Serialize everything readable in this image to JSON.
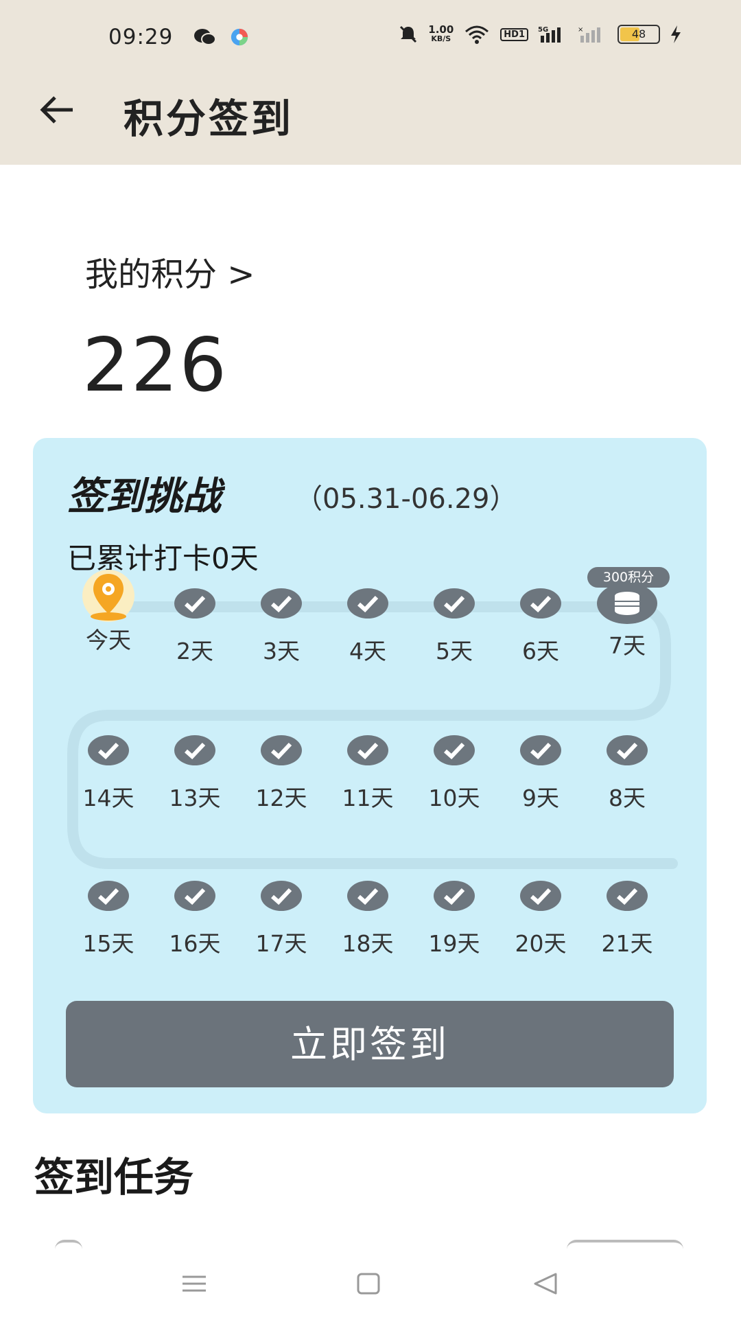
{
  "status_bar": {
    "time": "09:29",
    "speed_top": "1.00",
    "speed_bottom": "KB/S",
    "hd_badge": "HD1",
    "network": "5G",
    "battery": "48",
    "icons": [
      "wechat-icon",
      "app-icon",
      "mute-icon",
      "wifi-icon",
      "signal-icon",
      "charging-icon"
    ]
  },
  "header": {
    "back": "back-arrow-icon",
    "title": "积分签到"
  },
  "points": {
    "label": "我的积分 >",
    "value": "226"
  },
  "challenge": {
    "title": "签到挑战",
    "date_range": "（05.31-06.29）",
    "summary": "已累计打卡0天",
    "reward_tag": "300积分",
    "days_row1": [
      "今天",
      "2天",
      "3天",
      "4天",
      "5天",
      "6天",
      "7天"
    ],
    "days_row2": [
      "14天",
      "13天",
      "12天",
      "11天",
      "10天",
      "9天",
      "8天"
    ],
    "days_row3": [
      "15天",
      "16天",
      "17天",
      "18天",
      "19天",
      "20天",
      "21天"
    ],
    "button_label": "立即签到",
    "colors": {
      "card": "#cdeff9",
      "check": "#6d767e",
      "today_pin": "#f5a623",
      "button": "#6b737b"
    }
  },
  "tasks": {
    "title": "签到任务"
  },
  "navbar": {
    "icons": [
      "menu-icon",
      "home-icon",
      "back-icon"
    ]
  }
}
